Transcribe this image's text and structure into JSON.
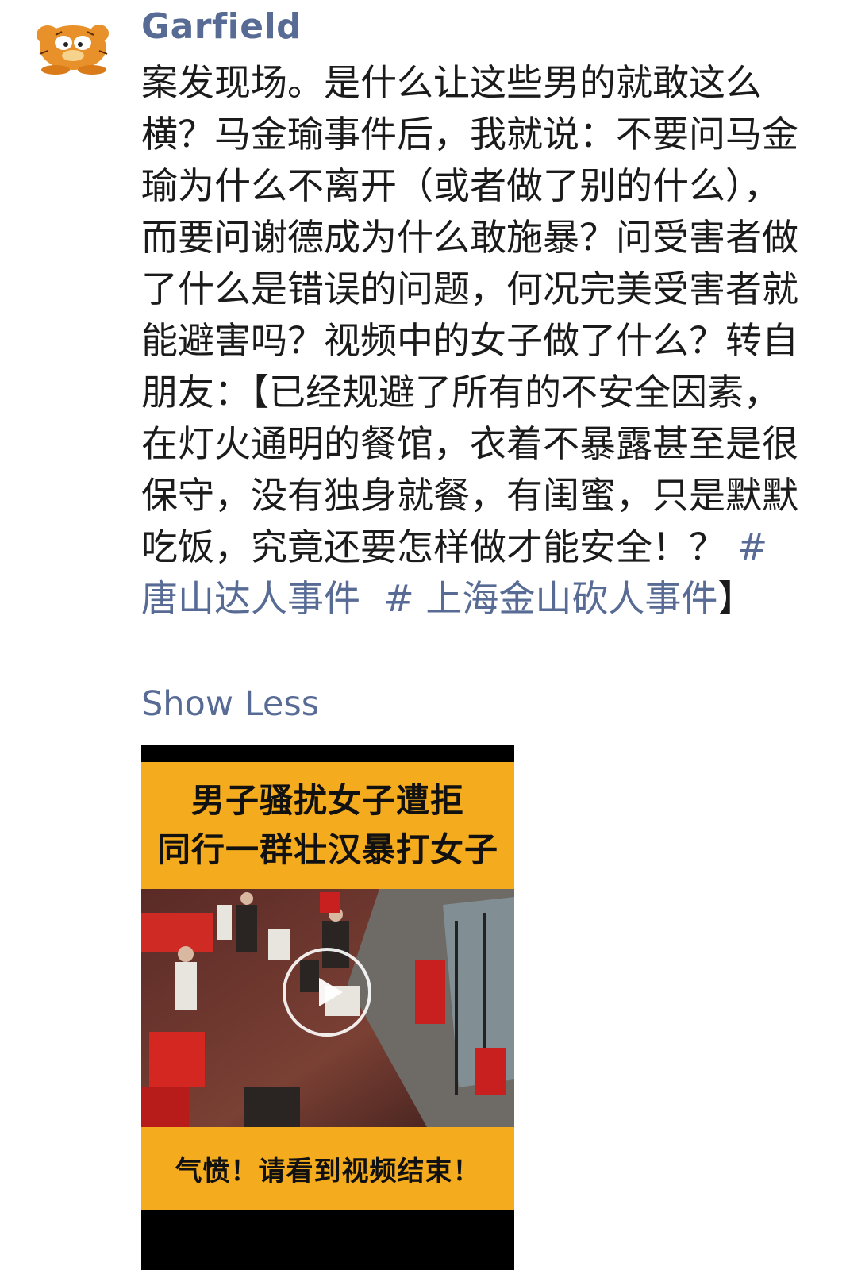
{
  "post": {
    "author": "Garfield",
    "avatar_icon": "garfield-cat-avatar",
    "text": "案发现场。是什么让这些男的就敢这么横？马金瑜事件后，我就说：不要问马金瑜为什么不离开（或者做了别的什么），而要问谢德成为什么敢施暴？问受害者做了什么是错误的问题，何况完美受害者就能避害吗？视频中的女子做了什么？转自朋友：【已经规避了所有的不安全因素，在灯火通明的餐馆，衣着不暴露甚至是很保守，没有独身就餐，有闺蜜，只是默默吃饭，究竟还要怎样做才能安全！？ ",
    "hashtag_1": "# 唐山达人事件",
    "hashtag_2": "# 上海金山砍人事件",
    "closing_bracket": "】",
    "show_less_label": "Show Less"
  },
  "video": {
    "banner_top_line1": "男子骚扰女子遭拒",
    "banner_top_line2": "同行一群壮汉暴打女子",
    "banner_bottom": "气愤！请看到视频结束！",
    "play_icon": "play-icon",
    "accent_color": "#f4ac1e",
    "link_color": "#576b95"
  }
}
